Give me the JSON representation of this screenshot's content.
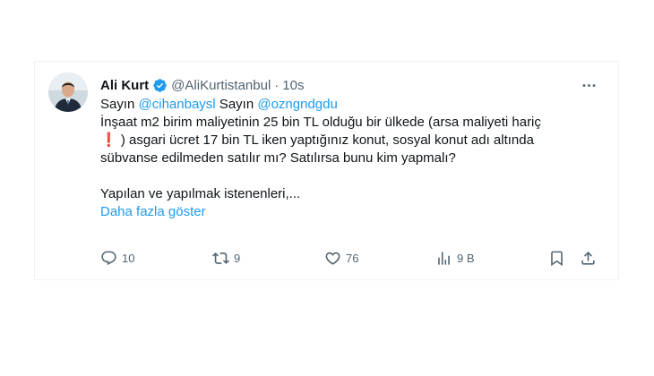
{
  "tweet": {
    "author": {
      "display_name": "Ali Kurt",
      "handle": "@AliKurtistanbul",
      "separator": "·",
      "time": "10s",
      "verified": true
    },
    "text": {
      "line1_prefix": "Sayın ",
      "mention1": "@cihanbaysl",
      "line1_mid": " Sayın ",
      "mention2": "@ozngndgdu",
      "line2": "İnşaat m2 birim maliyetinin 25 bin TL olduğu bir ülkede (arsa maliyeti hariç",
      "line3_emoji": "❗",
      "line3": " ) asgari ücret 17 bin TL iken yaptığınız konut, sosyal konut adı altında",
      "line4": "sübvanse edilmeden satılır mı? Satılırsa bunu kim yapmalı?",
      "line5": "Yapılan ve yapılmak istenenleri,...",
      "show_more": "Daha fazla göster"
    },
    "actions": {
      "reply_count": "10",
      "retweet_count": "9",
      "like_count": "76",
      "views_count": "9 B",
      "reply_icon": "reply-icon",
      "retweet_icon": "retweet-icon",
      "like_icon": "heart-icon",
      "views_icon": "views-icon",
      "bookmark_icon": "bookmark-icon",
      "share_icon": "share-icon"
    },
    "colors": {
      "link": "#1d9bf0",
      "muted": "#536471",
      "text": "#0f1419",
      "verified": "#1d9bf0"
    }
  }
}
